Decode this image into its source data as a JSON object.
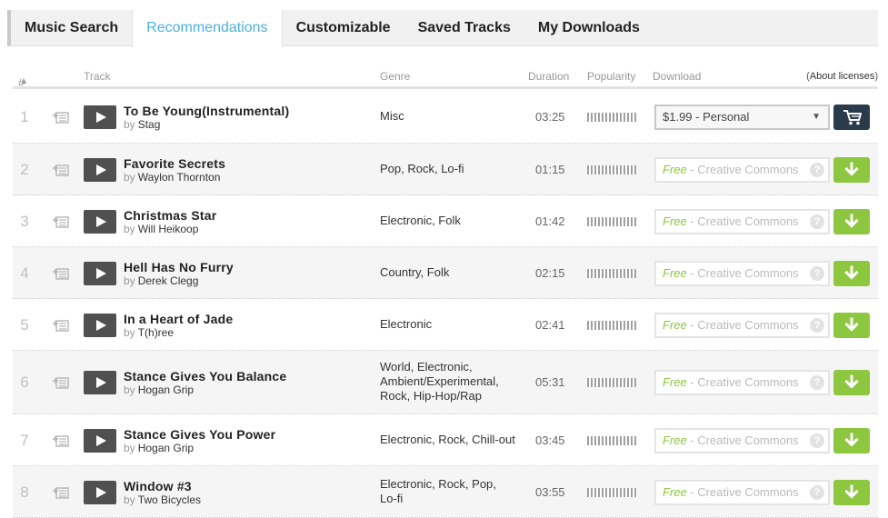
{
  "tabs": [
    {
      "label": "Music Search"
    },
    {
      "label": "Recommendations"
    },
    {
      "label": "Customizable"
    },
    {
      "label": "Saved Tracks"
    },
    {
      "label": "My Downloads"
    }
  ],
  "columns": {
    "num": "#",
    "num_sort_icon": "sort-up-icon",
    "track": "Track",
    "genre": "Genre",
    "duration": "Duration",
    "popularity": "Popularity",
    "download": "Download",
    "about_open": "(",
    "about_link": "About licenses",
    "about_close": ")"
  },
  "by_label": "by",
  "rows": [
    {
      "num": "1",
      "title": "To Be Young(Instrumental)",
      "artist": "Stag",
      "genre": "Misc",
      "duration": "03:25",
      "license": "$1.99 - Personal",
      "button_icon": "shopping-cart-icon"
    },
    {
      "num": "2",
      "title": "Favorite Secrets",
      "artist": "Waylon Thornton",
      "genre": "Pop, Rock, Lo-fi",
      "duration": "01:15",
      "free": "Free",
      "license": " - Creative Commons",
      "button_icon": "download-arrow-icon"
    },
    {
      "num": "3",
      "title": "Christmas Star",
      "artist": "Will Heikoop",
      "genre": "Electronic, Folk",
      "duration": "01:42",
      "free": "Free",
      "license": " - Creative Commons",
      "button_icon": "download-arrow-icon"
    },
    {
      "num": "4",
      "title": "Hell Has No Furry",
      "artist": "Derek Clegg",
      "genre": "Country, Folk",
      "duration": "02:15",
      "free": "Free",
      "license": " - Creative Commons",
      "button_icon": "download-arrow-icon"
    },
    {
      "num": "5",
      "title": "In a Heart of Jade",
      "artist": "T(h)ree",
      "genre": "Electronic",
      "duration": "02:41",
      "free": "Free",
      "license": " - Creative Commons",
      "button_icon": "download-arrow-icon"
    },
    {
      "num": "6",
      "title": "Stance Gives You Balance",
      "artist": "Hogan Grip",
      "genre": "World, Electronic, Ambient/Experimental, Rock, Hip-Hop/Rap",
      "duration": "05:31",
      "free": "Free",
      "license": " - Creative Commons",
      "button_icon": "download-arrow-icon"
    },
    {
      "num": "7",
      "title": "Stance Gives You Power",
      "artist": "Hogan Grip",
      "genre": "Electronic, Rock, Chill-out",
      "duration": "03:45",
      "free": "Free",
      "license": " - Creative Commons",
      "button_icon": "download-arrow-icon"
    },
    {
      "num": "8",
      "title": "Window #3",
      "artist": "Two Bicycles",
      "genre": "Electronic, Rock, Pop, Lo-fi",
      "duration": "03:55",
      "free": "Free",
      "license": " - Creative Commons",
      "button_icon": "download-arrow-icon"
    }
  ],
  "help_glyph": "?",
  "select_caret": "▼",
  "colors": {
    "accent_blue": "#4ab1e2",
    "download_green": "#8dc63f",
    "cart_navy": "#2a3b4c"
  }
}
